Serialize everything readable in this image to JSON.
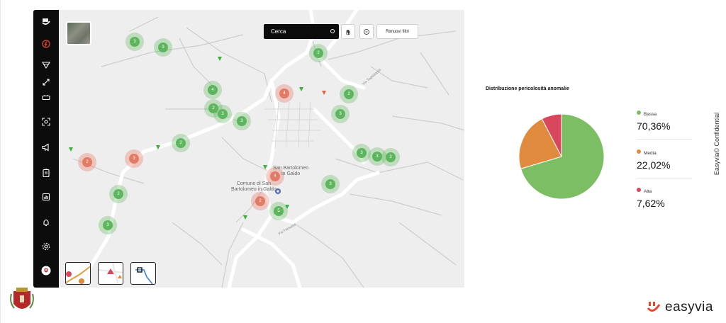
{
  "map": {
    "search": {
      "value": "Cerca",
      "icon": "target-icon"
    },
    "toolbar": {
      "hand_icon": "hand-pointer-icon",
      "reset_icon": "reset-circle-icon",
      "clear_filters_label": "Rimuovi filtri"
    },
    "labels": {
      "place_a_line1": "San Bartolomeo",
      "place_a_line2": "in Galdo",
      "place_b_line1": "Comune di San",
      "place_b_line2": "Bartolomeo in Galdo",
      "road_a": "Via Taglialatelli",
      "road_b": "Via Parisella"
    },
    "clusters": [
      {
        "count": "3",
        "severity": "green"
      },
      {
        "count": "3",
        "severity": "green"
      },
      {
        "count": "2",
        "severity": "green"
      },
      {
        "count": "4",
        "severity": "red"
      },
      {
        "count": "2",
        "severity": "green"
      },
      {
        "count": "4",
        "severity": "green"
      },
      {
        "count": "2",
        "severity": "green"
      },
      {
        "count": "3",
        "severity": "green"
      },
      {
        "count": "3",
        "severity": "green"
      },
      {
        "count": "3",
        "severity": "green"
      },
      {
        "count": "2",
        "severity": "green"
      },
      {
        "count": "3",
        "severity": "green"
      },
      {
        "count": "2",
        "severity": "red"
      },
      {
        "count": "3",
        "severity": "green"
      },
      {
        "count": "3",
        "severity": "green"
      },
      {
        "count": "2",
        "severity": "red"
      },
      {
        "count": "4",
        "severity": "green"
      },
      {
        "count": "3",
        "severity": "red"
      },
      {
        "count": "2",
        "severity": "green"
      },
      {
        "count": "2",
        "severity": "green"
      },
      {
        "count": "5",
        "severity": "red"
      },
      {
        "count": "3",
        "severity": "green"
      }
    ]
  },
  "sidebar": {
    "logo_icon": "easyvia-logo-icon",
    "items": [
      {
        "name": "anomaly-icon",
        "active": true
      },
      {
        "name": "filter-icon"
      },
      {
        "name": "measure-icon"
      },
      {
        "name": "battery-icon"
      },
      {
        "name": "scan-icon"
      },
      {
        "name": "megaphone-icon"
      },
      {
        "name": "clipboard-icon"
      },
      {
        "name": "report-icon"
      },
      {
        "name": "bell-icon"
      },
      {
        "name": "settings-icon"
      }
    ]
  },
  "chart_data": {
    "type": "pie",
    "title": "Distribuzione pericolosità anomalie",
    "categories": [
      "Bassa",
      "Media",
      "Alta"
    ],
    "values": [
      70.36,
      22.02,
      7.62
    ],
    "value_labels": [
      "70,36%",
      "22,02%",
      "7,62%"
    ],
    "colors": [
      "#7cbe63",
      "#df8a3c",
      "#d9475c"
    ],
    "legend": "right"
  },
  "watermark": "Easyvia© Confidential",
  "footer": {
    "brand": "easyvia",
    "accent": "#e8452c"
  }
}
